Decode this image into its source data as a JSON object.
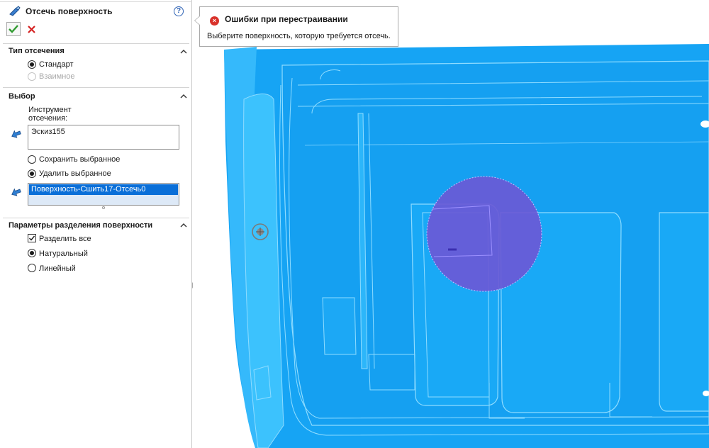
{
  "panel": {
    "title": "Отсечь поверхность",
    "help_label": "?",
    "title_icon": "trim-surface-icon",
    "ok_icon": "green-check-icon",
    "cancel_icon": "red-x-icon"
  },
  "trim_type": {
    "heading": "Тип отсечения",
    "options": [
      {
        "label": "Стандарт",
        "selected": true,
        "enabled": true
      },
      {
        "label": "Взаимное",
        "selected": false,
        "enabled": false
      }
    ]
  },
  "selection": {
    "heading": "Выбор",
    "trim_tool_label": "Инструмент отсечения:",
    "trim_tool_label_line1": "Инструмент",
    "trim_tool_label_line2": "отсечения:",
    "trim_tool_value": "Эскиз155",
    "keep_options": [
      {
        "label": "Сохранить выбранное",
        "selected": false
      },
      {
        "label": "Удалить выбранное",
        "selected": true
      }
    ],
    "pieces_list": [
      "Поверхность-Сшить17-Отсечь0"
    ]
  },
  "split_options": {
    "heading": "Параметры разделения поверхности",
    "split_all": {
      "label": "Разделить все",
      "checked": true
    },
    "modes": [
      {
        "label": "Натуральный",
        "selected": true
      },
      {
        "label": "Линейный",
        "selected": false
      }
    ]
  },
  "error_tooltip": {
    "title": "Ошибки при перестраивании",
    "message": "Выберите поверхность, которую требуется отсечь.",
    "icon": "error-circle-icon"
  },
  "colors": {
    "surface": "#15a6f5",
    "surface_light": "#2fbdf9",
    "edges": "#8fdcff",
    "highlight": "#6a59d6",
    "selection_blue": "#0a6fd8",
    "error_red": "#d9322b",
    "accept_green": "#2f9a2f",
    "cancel_red": "#d42020"
  }
}
